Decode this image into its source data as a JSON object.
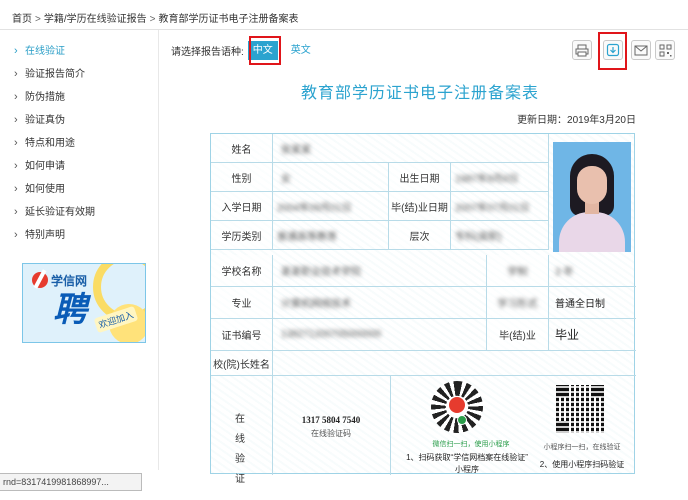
{
  "breadcrumb": [
    "首页",
    "学籍/学历在线验证报告",
    "教育部学历证书电子注册备案表"
  ],
  "breadcrumb_sep": ">",
  "sidebar": {
    "items": [
      {
        "label": "在线验证",
        "active": true
      },
      {
        "label": "验证报告简介"
      },
      {
        "label": "防伪措施"
      },
      {
        "label": "验证真伪"
      },
      {
        "label": "特点和用途"
      },
      {
        "label": "如何申请"
      },
      {
        "label": "如何使用"
      },
      {
        "label": "延长验证有效期"
      },
      {
        "label": "特别声明"
      }
    ],
    "chevron": "›"
  },
  "banner": {
    "brand": "学信网",
    "headline": "聘",
    "tagline": "欢迎加入"
  },
  "language": {
    "prompt": "请选择报告语种:",
    "zh": "中文",
    "en": "英文"
  },
  "toolbar": {
    "print": "print-icon",
    "download": "download-icon",
    "mail": "mail-icon",
    "qr": "qr-code-icon"
  },
  "document": {
    "title": "教育部学历证书电子注册备案表",
    "update_date": "更新日期：2019年3月20日"
  },
  "cert": {
    "labels": {
      "name": "姓名",
      "gender": "性别",
      "birth": "出生日期",
      "enroll": "入学日期",
      "grad": "毕(结)业日期",
      "edu_type": "学历类别",
      "level": "层次",
      "school": "学校名称",
      "duration": "学制",
      "major": "专业",
      "study_form": "学习形式",
      "cert_no": "证书编号",
      "grad_status": "毕(结)业",
      "president": "校(院)长姓名"
    },
    "values": {
      "name": "张某某",
      "gender": "女",
      "birth": "1987年8月8日",
      "enroll": "2004年09月01日",
      "grad": "2007年07月01日",
      "edu_type": "普通高等教育",
      "level": "专科(高职)",
      "school": "某某职业技术学院",
      "duration": "3 年",
      "major": "计算机网络技术",
      "study_form": "普通全日制",
      "cert_no": "138271200705000000",
      "grad_status": "毕业"
    },
    "verify": {
      "label_chars": [
        "在",
        "线",
        "验",
        "证"
      ],
      "code": "1317 5804 7540",
      "code_label": "在线验证码",
      "wx_tip": "微信扫一扫，使用小程序",
      "step1_a": "1、扫码获取“学信网档案在线验证”",
      "step1_b": "小程序",
      "mini_tip": "小程序扫一扫，在线验证",
      "step2": "2、使用小程序扫码验证"
    }
  },
  "status_bar": {
    "text": "rnd=8317419981868997..."
  },
  "colors": {
    "accent": "#2ba3cf",
    "highlight_box": "#e0151a",
    "border": "#9fd3e6"
  }
}
